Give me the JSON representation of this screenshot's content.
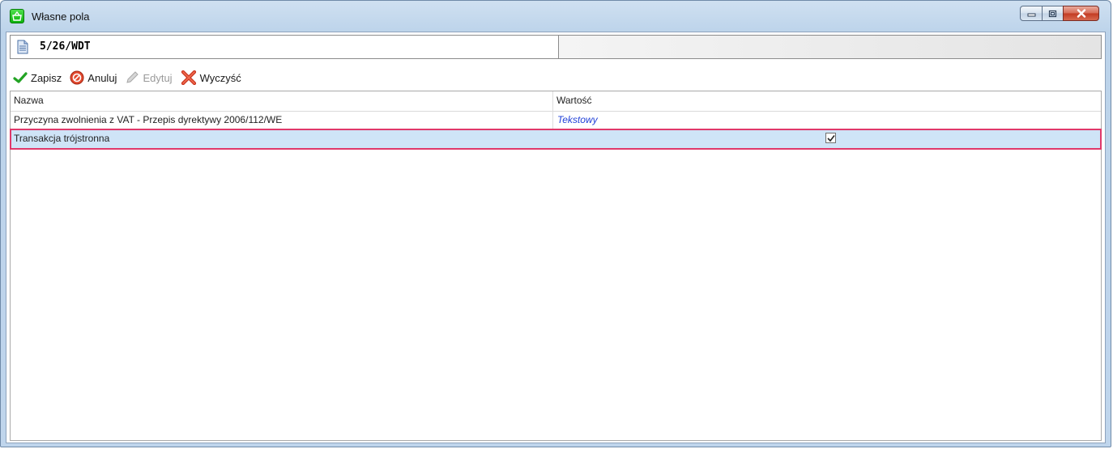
{
  "window": {
    "title": "Własne pola",
    "accent_color": "#1cc11c"
  },
  "document": {
    "number": "5/26/WDT"
  },
  "toolbar": {
    "save_label": "Zapisz",
    "cancel_label": "Anuluj",
    "edit_label": "Edytuj",
    "clear_label": "Wyczyść"
  },
  "grid": {
    "columns": [
      "Nazwa",
      "Wartość"
    ],
    "rows": [
      {
        "name": "Przyczyna zwolnienia z VAT - Przepis dyrektywy 2006/112/WE",
        "value": "Tekstowy"
      },
      {
        "name": "Transakcja trójstronna",
        "value_checked": true
      }
    ],
    "selected_row_outline_color": "#e0386a"
  }
}
